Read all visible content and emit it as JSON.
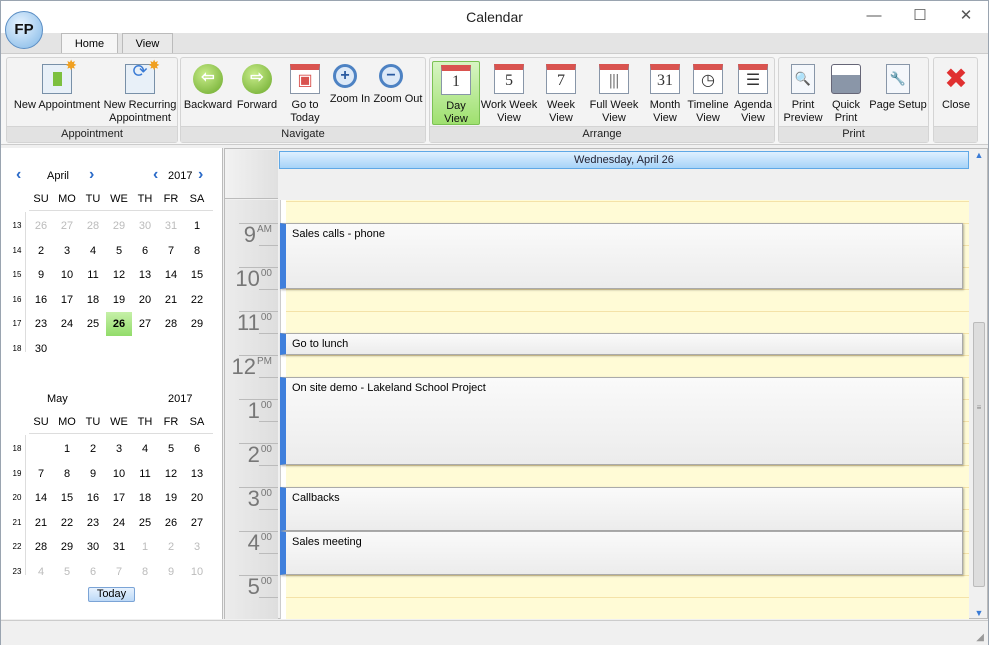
{
  "window": {
    "title": "Calendar",
    "logo_text": "FP"
  },
  "tabs": [
    {
      "label": "Home",
      "active": true
    },
    {
      "label": "View",
      "active": false
    }
  ],
  "ribbon": {
    "groups": [
      {
        "label": "Appointment",
        "buttons": [
          {
            "label": "New Appointment",
            "icon": "new-appointment-icon"
          },
          {
            "label": "New Recurring Appointment",
            "icon": "new-recurring-icon"
          }
        ]
      },
      {
        "label": "Navigate",
        "buttons": [
          {
            "label": "Backward",
            "icon": "arrow-left-icon"
          },
          {
            "label": "Forward",
            "icon": "arrow-right-icon"
          },
          {
            "label": "Go to Today",
            "icon": "calendar-today-icon"
          },
          {
            "label": "Zoom In",
            "icon": "zoom-in-icon"
          },
          {
            "label": "Zoom Out",
            "icon": "zoom-out-icon"
          }
        ]
      },
      {
        "label": "Arrange",
        "buttons": [
          {
            "label": "Day View",
            "glyph": "1",
            "active": true
          },
          {
            "label": "Work Week View",
            "glyph": "5"
          },
          {
            "label": "Week View",
            "glyph": "7"
          },
          {
            "label": "Full Week View",
            "glyph": "|||"
          },
          {
            "label": "Month View",
            "glyph": "31"
          },
          {
            "label": "Timeline View",
            "glyph": "◷"
          },
          {
            "label": "Agenda View",
            "glyph": "☰"
          }
        ]
      },
      {
        "label": "Print",
        "buttons": [
          {
            "label": "Print Preview",
            "icon": "print-preview-icon"
          },
          {
            "label": "Quick Print",
            "icon": "printer-icon"
          },
          {
            "label": "Page Setup",
            "icon": "page-setup-icon"
          }
        ]
      },
      {
        "label": "",
        "buttons": [
          {
            "label": "Close",
            "icon": "close-icon"
          }
        ]
      }
    ]
  },
  "sidebar": {
    "weekday_headers": [
      "SU",
      "MO",
      "TU",
      "WE",
      "TH",
      "FR",
      "SA"
    ],
    "today_label": "Today",
    "months": [
      {
        "name": "April",
        "year": "2017",
        "weeks": [
          {
            "num": "13",
            "days": [
              "26",
              "27",
              "28",
              "29",
              "30",
              "31",
              "1"
            ],
            "dim": [
              0,
              1,
              2,
              3,
              4,
              5
            ]
          },
          {
            "num": "14",
            "days": [
              "2",
              "3",
              "4",
              "5",
              "6",
              "7",
              "8"
            ]
          },
          {
            "num": "15",
            "days": [
              "9",
              "10",
              "11",
              "12",
              "13",
              "14",
              "15"
            ]
          },
          {
            "num": "16",
            "days": [
              "16",
              "17",
              "18",
              "19",
              "20",
              "21",
              "22"
            ]
          },
          {
            "num": "17",
            "days": [
              "23",
              "24",
              "25",
              "26",
              "27",
              "28",
              "29"
            ],
            "selected": 3
          },
          {
            "num": "18",
            "days": [
              "30",
              "",
              "",
              "",
              "",
              "",
              ""
            ]
          }
        ]
      },
      {
        "name": "May",
        "year": "2017",
        "weeks": [
          {
            "num": "18",
            "days": [
              "",
              "1",
              "2",
              "3",
              "4",
              "5",
              "6"
            ]
          },
          {
            "num": "19",
            "days": [
              "7",
              "8",
              "9",
              "10",
              "11",
              "12",
              "13"
            ]
          },
          {
            "num": "20",
            "days": [
              "14",
              "15",
              "16",
              "17",
              "18",
              "19",
              "20"
            ]
          },
          {
            "num": "21",
            "days": [
              "21",
              "22",
              "23",
              "24",
              "25",
              "26",
              "27"
            ]
          },
          {
            "num": "22",
            "days": [
              "28",
              "29",
              "30",
              "31",
              "1",
              "2",
              "3"
            ],
            "dim": [
              4,
              5,
              6
            ]
          },
          {
            "num": "23",
            "days": [
              "4",
              "5",
              "6",
              "7",
              "8",
              "9",
              "10"
            ],
            "dim": [
              0,
              1,
              2,
              3,
              4,
              5,
              6
            ]
          }
        ]
      }
    ]
  },
  "day_view": {
    "date_header": "Wednesday, April 26",
    "hours": [
      {
        "h": "9",
        "s": "AM"
      },
      {
        "h": "10",
        "s": "00"
      },
      {
        "h": "11",
        "s": "00"
      },
      {
        "h": "12",
        "s": "PM"
      },
      {
        "h": "1",
        "s": "00"
      },
      {
        "h": "2",
        "s": "00"
      },
      {
        "h": "3",
        "s": "00"
      },
      {
        "h": "4",
        "s": "00"
      },
      {
        "h": "5",
        "s": "00"
      }
    ],
    "appointments": [
      {
        "subject": "Sales calls - phone",
        "start": "9:00",
        "end": "10:30"
      },
      {
        "subject": "Go to lunch",
        "start": "11:30",
        "end": "12:00"
      },
      {
        "subject": "On site demo  - Lakeland School Project",
        "start": "12:30",
        "end": "14:30"
      },
      {
        "subject": "Callbacks",
        "start": "15:00",
        "end": "16:00"
      },
      {
        "subject": "Sales meeting",
        "start": "16:00",
        "end": "17:00"
      }
    ]
  },
  "colors": {
    "accent": "#3f7fdc",
    "selected_day": "#a6e27c",
    "work_hours": "#fffbd6"
  }
}
